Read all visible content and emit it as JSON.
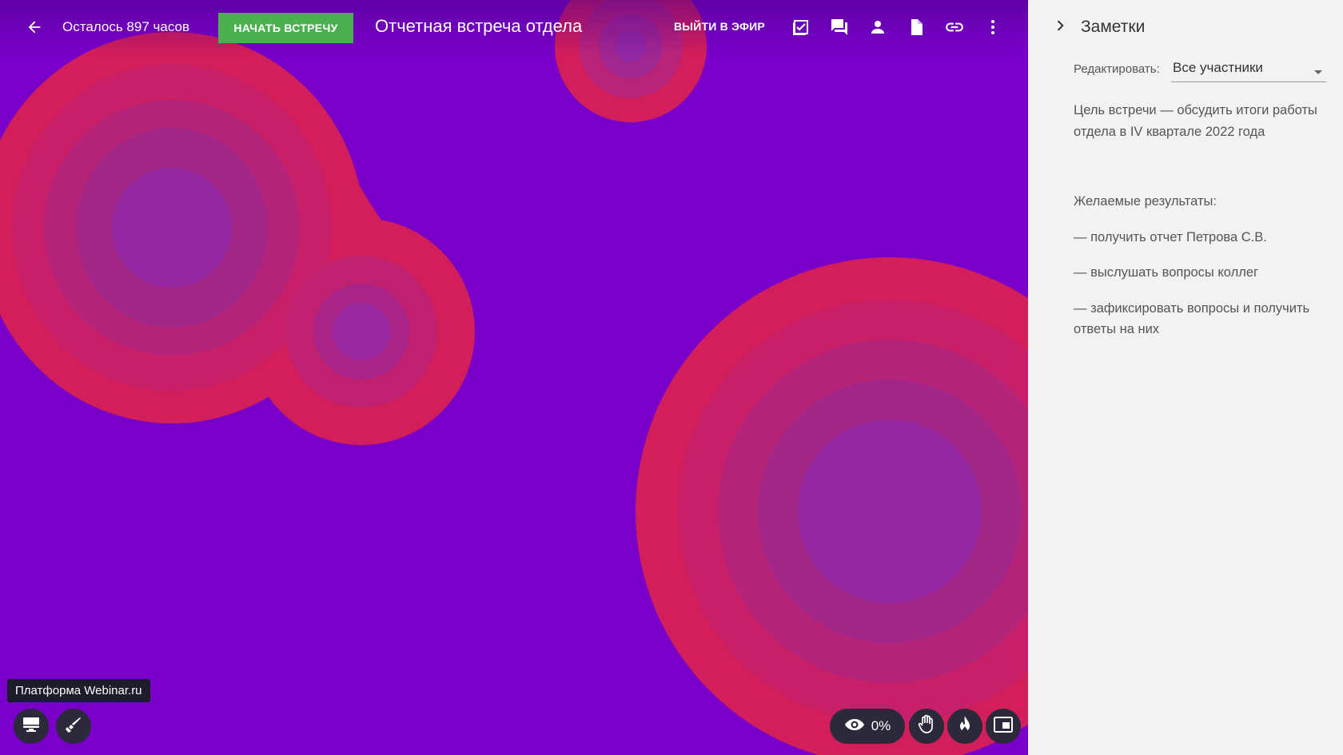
{
  "topbar": {
    "time_left": "Осталось 897 часов",
    "start_button": "НАЧАТЬ ВСТРЕЧУ",
    "meeting_title": "Отчетная встреча отдела",
    "go_live_button": "ВЫЙТИ В ЭФИР",
    "icons": [
      "arrow-back-icon",
      "checklist-icon",
      "chat-icon",
      "person-icon",
      "document-icon",
      "link-icon",
      "more-vert-icon"
    ]
  },
  "stage": {
    "brand_label": "Платформа Webinar.ru",
    "viewers_percent": "0%",
    "bottom_left_icons": [
      "monitor-icon",
      "brush-icon"
    ],
    "bottom_right_icons": [
      "eye-icon",
      "raise-hand-icon",
      "flame-icon",
      "picture-in-picture-icon"
    ]
  },
  "notes_panel": {
    "title": "Заметки",
    "edit_label": "Редактировать:",
    "edit_value": "Все участники",
    "paragraph_1": "Цель встречи — обсудить итоги работы отдела в IV квартале 2022 года",
    "paragraph_2": "Желаемые результаты:",
    "bullet_1": "— получить отчет Петрова С.В.",
    "bullet_2": "— выслушать вопросы коллег",
    "bullet_3": "— зафиксировать вопросы и получить ответы на них"
  },
  "colors": {
    "stage_background": "#7800c8",
    "blob_accent": "#d21e5a",
    "start_button": "#4caf50",
    "panel_background": "#f2f2f2"
  }
}
